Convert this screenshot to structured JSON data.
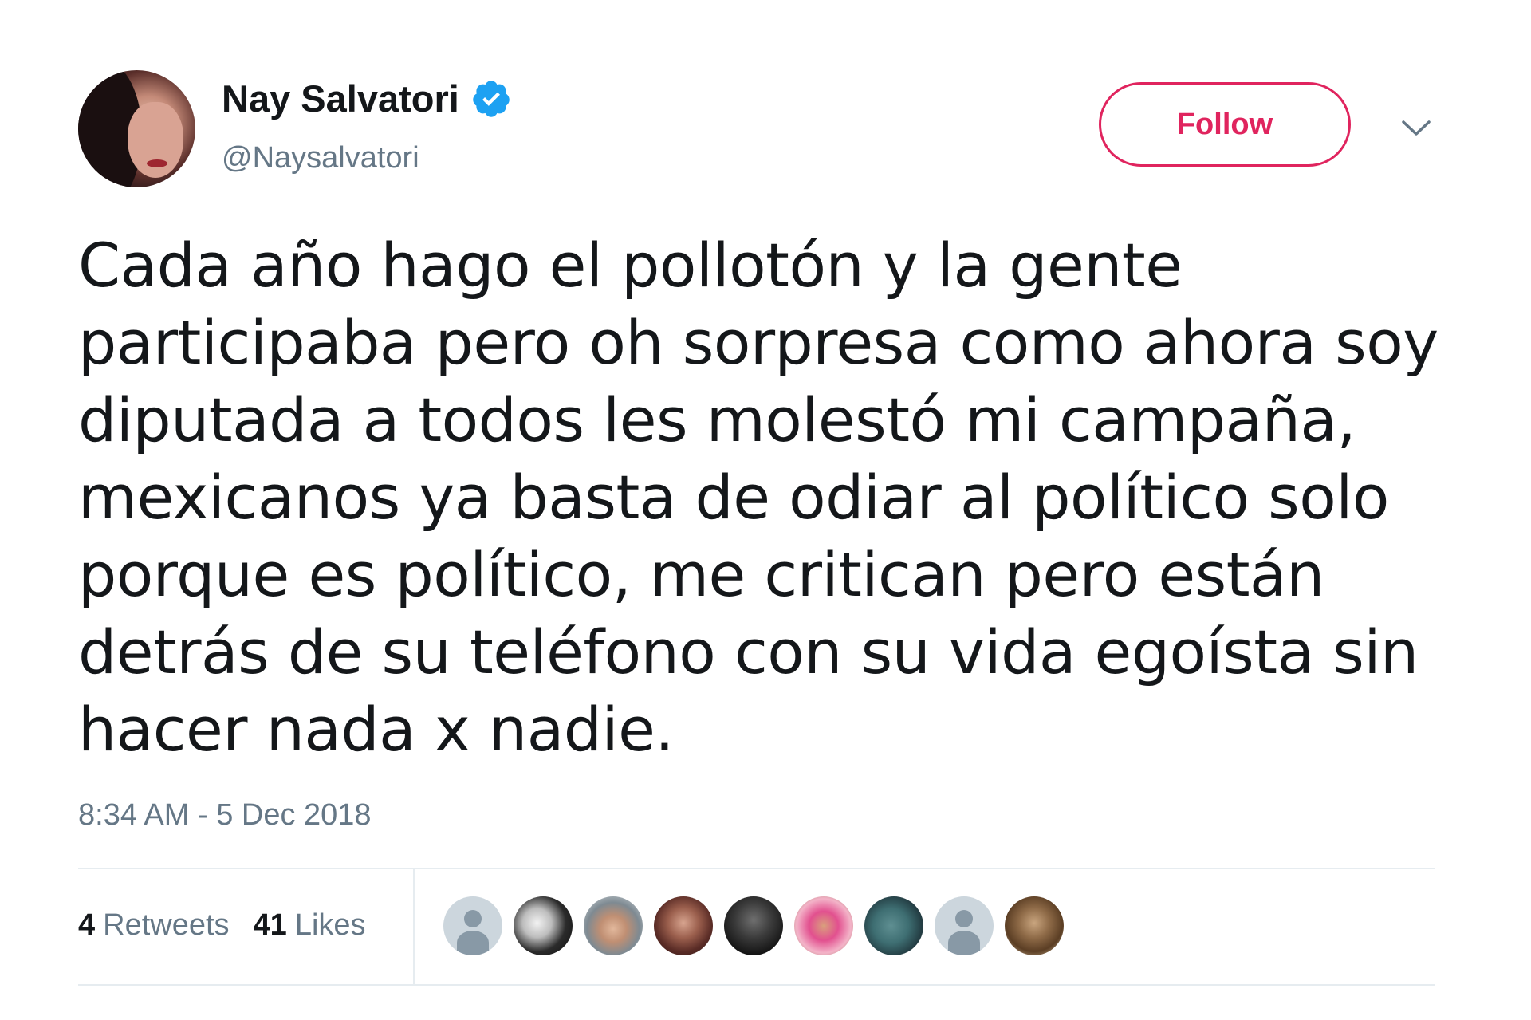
{
  "user": {
    "display_name": "Nay Salvatori",
    "handle": "@Naysalvatori",
    "verified": true
  },
  "header": {
    "follow_label": "Follow"
  },
  "tweet": {
    "text": "Cada año hago el pollotón y la gente\nparticipaba pero oh sorpresa como ahora soy\ndiputada a todos les molestó mi campaña,\nmexicanos ya basta de odiar al político solo\nporque es político, me critican pero están\ndetrás de su teléfono con su vida egoísta sin\nhacer nada x nadie.",
    "timestamp": "8:34 AM - 5 Dec 2018"
  },
  "stats": {
    "retweets_count": "4",
    "retweets_label": "Retweets",
    "likes_count": "41",
    "likes_label": "Likes"
  },
  "colors": {
    "accent": "#e0245e",
    "verified": "#1da1f2",
    "muted": "#657786",
    "text": "#14171a",
    "divider": "#e6ecf0"
  },
  "icons": {
    "verified": "verified-badge-icon",
    "caret": "chevron-down-icon",
    "default_avatar": "default-profile-icon"
  }
}
